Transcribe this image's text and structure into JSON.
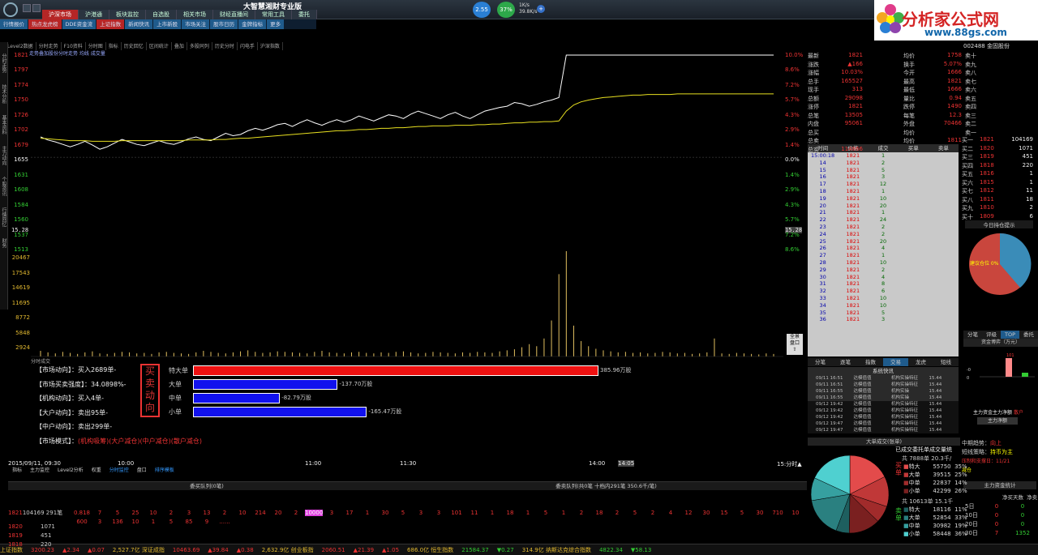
{
  "app": {
    "title": "大智慧湘财专业版"
  },
  "top_tabs": [
    "沪深市场",
    "沪港通",
    "板块监控",
    "自选股",
    "相关市场",
    "财经直播间",
    "常用工具",
    "委托"
  ],
  "active_top_tab": "沪深市场",
  "secondary_menu": [
    "行情报价",
    "热点龙虎榜",
    "DDE资金流",
    "上证指数",
    "新闻快讯",
    "上市新股",
    "市场关注",
    "股市日历",
    "金牌指标",
    "更多"
  ],
  "indicators": [
    {
      "value": "2.55"
    },
    {
      "value": "37%"
    }
  ],
  "net_speed": {
    "up": "1K/s",
    "down": "39.8K/s"
  },
  "brand": {
    "name": "分析家公式网",
    "url": "www.88gs.com"
  },
  "chart_toolbar": [
    "Level2数据",
    "分时走势",
    "F10资料",
    "分时图",
    "指标",
    "历史回忆",
    "区间统计",
    "叠加",
    "多股同列",
    "历史分时",
    "闪电手",
    "沪深指数"
  ],
  "chart_subtitle": "走势叠加股份分时走势 均线 成交量",
  "left_sidebar": [
    "分时走势",
    "技术分析",
    "基本资料",
    "主力动向",
    "个股资讯",
    "行情回忆",
    "财务"
  ],
  "y_left": [
    "1821",
    "1797",
    "1774",
    "1750",
    "1726",
    "1702",
    "1679",
    "1655",
    "1631",
    "1608",
    "1584",
    "1560",
    "1537",
    "1513"
  ],
  "y_right": [
    "10.0%",
    "8.6%",
    "7.2%",
    "5.7%",
    "4.3%",
    "2.9%",
    "1.4%",
    "0.0%",
    "1.4%",
    "2.9%",
    "4.3%",
    "5.7%",
    "7.2%",
    "8.6%"
  ],
  "crosshair_price": "15.28",
  "vol_labels": [
    "20467",
    "17543",
    "14619",
    "11695",
    "8772",
    "5848",
    "2924"
  ],
  "vol_title": "分时成交",
  "time_axis": [
    "2015/09/11, 09:30",
    "10:00",
    "11:00",
    "11:30",
    "14:00",
    "14:05",
    "15:分时▲"
  ],
  "quote_left": [
    {
      "k": "最新",
      "v": "1821"
    },
    {
      "k": "涨跌",
      "v": "▲166"
    },
    {
      "k": "涨幅",
      "v": "10.03%"
    },
    {
      "k": "总手",
      "v": "165527"
    },
    {
      "k": "现手",
      "v": "313"
    },
    {
      "k": "总额",
      "v": "29098"
    },
    {
      "k": "涨停",
      "v": "1821"
    },
    {
      "k": "总笔",
      "v": "13505"
    },
    {
      "k": "内盘",
      "v": "95061"
    },
    {
      "k": "总买",
      "v": ""
    },
    {
      "k": "总卖",
      "v": ""
    },
    {
      "k": "总实",
      "v": "114866"
    }
  ],
  "quote_right": [
    {
      "k": "均价",
      "v": "1758"
    },
    {
      "k": "换手",
      "v": "5.07%"
    },
    {
      "k": "今开",
      "v": "1666"
    },
    {
      "k": "最高",
      "v": "1821"
    },
    {
      "k": "最低",
      "v": "1666"
    },
    {
      "k": "量比",
      "v": "0.94"
    },
    {
      "k": "跌停",
      "v": "1490"
    },
    {
      "k": "每笔",
      "v": "12.3"
    },
    {
      "k": "外盘",
      "v": "70466"
    },
    {
      "k": "均价",
      "v": ""
    },
    {
      "k": "均价",
      "v": "1811"
    }
  ],
  "sell_levels": [
    "卖十",
    "卖九",
    "卖八",
    "卖七",
    "卖六",
    "卖五",
    "卖四",
    "卖三",
    "卖二",
    "卖一"
  ],
  "buy_levels": [
    {
      "name": "买一",
      "price": "1821",
      "vol": "104169"
    },
    {
      "name": "买二",
      "price": "1820",
      "vol": "1071"
    },
    {
      "name": "买三",
      "price": "1819",
      "vol": "451"
    },
    {
      "name": "买四",
      "price": "1818",
      "vol": "220"
    },
    {
      "name": "买五",
      "price": "1816",
      "vol": "1"
    },
    {
      "name": "买六",
      "price": "1815",
      "vol": "1"
    },
    {
      "name": "买七",
      "price": "1812",
      "vol": "11"
    },
    {
      "name": "买八",
      "price": "1811",
      "vol": "18"
    },
    {
      "name": "买九",
      "price": "1810",
      "vol": "2"
    },
    {
      "name": "买十",
      "price": "1809",
      "vol": "6"
    }
  ],
  "stock_code": "002488 金固股份",
  "trade_headers": [
    "时间",
    "价格",
    "成交",
    "买单",
    "卖单"
  ],
  "trades": [
    {
      "t": "15:00:18",
      "p": "1821",
      "v": "1"
    },
    {
      "t": "14",
      "p": "1821",
      "v": "2"
    },
    {
      "t": "15",
      "p": "1821",
      "v": "5"
    },
    {
      "t": "16",
      "p": "1821",
      "v": "3"
    },
    {
      "t": "17",
      "p": "1821",
      "v": "12"
    },
    {
      "t": "18",
      "p": "1821",
      "v": "1"
    },
    {
      "t": "19",
      "p": "1821",
      "v": "10"
    },
    {
      "t": "20",
      "p": "1821",
      "v": "20"
    },
    {
      "t": "21",
      "p": "1821",
      "v": "1"
    },
    {
      "t": "22",
      "p": "1821",
      "v": "24"
    },
    {
      "t": "23",
      "p": "1821",
      "v": "2"
    },
    {
      "t": "24",
      "p": "1821",
      "v": "2"
    },
    {
      "t": "25",
      "p": "1821",
      "v": "20"
    },
    {
      "t": "26",
      "p": "1821",
      "v": "4"
    },
    {
      "t": "27",
      "p": "1821",
      "v": "1"
    },
    {
      "t": "28",
      "p": "1821",
      "v": "10"
    },
    {
      "t": "29",
      "p": "1821",
      "v": "2"
    },
    {
      "t": "30",
      "p": "1821",
      "v": "4"
    },
    {
      "t": "31",
      "p": "1821",
      "v": "8"
    },
    {
      "t": "32",
      "p": "1821",
      "v": "6"
    },
    {
      "t": "33",
      "p": "1821",
      "v": "10"
    },
    {
      "t": "34",
      "p": "1821",
      "v": "10"
    },
    {
      "t": "35",
      "p": "1821",
      "v": "5"
    },
    {
      "t": "36",
      "p": "1821",
      "v": "3"
    }
  ],
  "trade_tabs": [
    "分笔",
    "逐笔",
    "指数",
    "交易",
    "龙虎",
    "短线"
  ],
  "pie1": {
    "title": "今日持仓提示",
    "label": "建议仓位 0%"
  },
  "right_tabs": [
    "分笔",
    "评级",
    "TOP",
    "委托"
  ],
  "mini_chart": {
    "title": "资金博弈（万元）",
    "caption": "主力资金主力净额",
    "caption2": "散户",
    "button": "主力净额",
    "val": "101"
  },
  "news_title": "系统快讯",
  "news_items": [
    {
      "d": "09/11 16:51",
      "a": "达模值值",
      "b": "机构实操特征",
      "c": "15.44"
    },
    {
      "d": "09/11 16:51",
      "a": "达模值值",
      "b": "机构实操特征",
      "c": "15.44"
    },
    {
      "d": "09/11 16:55",
      "a": "达模值值",
      "b": "机构实操",
      "c": "15.44"
    },
    {
      "d": "09/11 16:55",
      "a": "达模值值",
      "b": "机构实操",
      "c": "15.44"
    },
    {
      "d": "09/12 19:42",
      "a": "达模值值",
      "b": "机构实操特征",
      "c": "15.44"
    },
    {
      "d": "09/12 19:42",
      "a": "达模值值",
      "b": "机构实操特征",
      "c": "15.44"
    },
    {
      "d": "09/12 19:42",
      "a": "达模值值",
      "b": "机构实操特征",
      "c": "15.44"
    },
    {
      "d": "09/12 19:47",
      "a": "达模值值",
      "b": "机构实操特征",
      "c": "15.44"
    },
    {
      "d": "09/12 19:47",
      "a": "达模值值",
      "b": "机构实操特征",
      "c": "15.44"
    }
  ],
  "signal": {
    "t1": "中期趋势：",
    "v1": "向上",
    "t2": "短线策略：",
    "v2": "持币为主",
    "t3": "压制和支撑日：11/21",
    "t4": "减仓"
  },
  "big_order_title": "主力资金统计",
  "big_order_sub": [
    "净买天数",
    "净卖（万）"
  ],
  "days": [
    {
      "d": "5日",
      "v": "0"
    },
    {
      "d": "10日",
      "v": "0"
    },
    {
      "d": "20日",
      "v": "0"
    },
    {
      "d": "30日",
      "v": "7",
      "v2": "1352"
    }
  ],
  "pie2": {
    "title": "大单成交(张单)",
    "head": "已成交委托单成交量统",
    "buy_total": "共 7888单 20.3千/",
    "sell_total": "共 10613单 15.1千"
  },
  "pie2_rows_buy": [
    {
      "k": "特大",
      "n": "55750",
      "p": "35%"
    },
    {
      "k": "大单",
      "n": "39515",
      "p": "25%"
    },
    {
      "k": "中单",
      "n": "22837",
      "p": "14%"
    },
    {
      "k": "小单",
      "n": "42299",
      "p": "26%"
    }
  ],
  "pie2_rows_sell": [
    {
      "k": "特大",
      "n": "18116",
      "p": "11%"
    },
    {
      "k": "大单",
      "n": "52854",
      "p": "33%"
    },
    {
      "k": "中单",
      "n": "30982",
      "p": "19%"
    },
    {
      "k": "小单",
      "n": "58448",
      "p": "36%"
    }
  ],
  "flows": [
    {
      "label": "【市场动向】：",
      "value": "买入2689单-"
    },
    {
      "label": "【市场买卖强度】：",
      "value": "34.0898%-"
    },
    {
      "label": "【机构动向】：",
      "value": "买入4单-"
    },
    {
      "label": "【大户动向】：",
      "value": "卖出95单-"
    },
    {
      "label": "【中户动向】：",
      "value": "卖出299单-"
    },
    {
      "label": "【市场模式】：",
      "value": "(机构吸筹)(大户减仓)(中户减仓)(散户减仓)"
    }
  ],
  "flow_vertical": "买卖动向",
  "bars": [
    {
      "name": "特大单",
      "value": 385.96,
      "text": "385.96万股",
      "color": "#ee1111"
    },
    {
      "name": "大单",
      "value": -137.7,
      "text": "-137.70万股",
      "color": "#1111ee"
    },
    {
      "name": "中单",
      "value": -82.79,
      "text": "-82.79万股",
      "color": "#1111ee"
    },
    {
      "name": "小单",
      "value": -165.47,
      "text": "-165.47万股",
      "color": "#1111ee"
    }
  ],
  "bottom_tabs": [
    "指标",
    "主力监控",
    "Level2分析",
    "权重",
    "分时监控",
    "盘口",
    "排序模板"
  ],
  "tape_headers": [
    "委买队列(0笔)",
    "委卖队列(共0笔 十档内291笔 350.6千/笔)"
  ],
  "tape_rows": [
    {
      "p": "1821",
      "v": "104169",
      "n": "291笔",
      "items": [
        "0.818",
        "7",
        "5",
        "25",
        "10",
        "2",
        "3",
        "13",
        "2",
        "10",
        "214",
        "20",
        "2",
        "10000",
        "3",
        "17",
        "1",
        "30",
        "5",
        "3",
        "3",
        "101",
        "11",
        "1",
        "18",
        "1",
        "5",
        "1",
        "2",
        "18",
        "2",
        "5",
        "2",
        "4",
        "12",
        "30",
        "15",
        "5",
        "30",
        "710",
        "10"
      ]
    },
    {
      "p": "",
      "v": "",
      "n": "",
      "items": [
        "600",
        "3",
        "136",
        "10",
        "1",
        "5",
        "85",
        "9",
        "......"
      ]
    }
  ],
  "tape_side": [
    {
      "p": "1820",
      "v": "1071"
    },
    {
      "p": "1819",
      "v": "451"
    },
    {
      "p": "1818",
      "v": "220"
    }
  ],
  "status": [
    {
      "t": "上证指数",
      "c": "#e2b930"
    },
    {
      "t": "3200.23",
      "c": "#e33"
    },
    {
      "t": "▲2.34",
      "c": "#e33"
    },
    {
      "t": "▲0.07",
      "c": "#e33"
    },
    {
      "t": "2,527.7亿 深证成指",
      "c": "#e2b930"
    },
    {
      "t": "10463.69",
      "c": "#e33"
    },
    {
      "t": "▲39.84",
      "c": "#e33"
    },
    {
      "t": "▲0.38",
      "c": "#e33"
    },
    {
      "t": "2,632.9亿 创业板指",
      "c": "#e2b930"
    },
    {
      "t": "2060.51",
      "c": "#e33"
    },
    {
      "t": "▲21.39",
      "c": "#e33"
    },
    {
      "t": "▲1.05",
      "c": "#e33"
    },
    {
      "t": "686.0亿 恒生指数",
      "c": "#e2b930"
    },
    {
      "t": "21584.37",
      "c": "#3c3"
    },
    {
      "t": "▼0.27",
      "c": "#3c3"
    },
    {
      "t": "314.9亿 纳斯达克综合指数",
      "c": "#e2b930"
    },
    {
      "t": "4822.34",
      "c": "#3c3"
    },
    {
      "t": "▼58.13",
      "c": "#3c3"
    }
  ],
  "chart_data": {
    "type": "line",
    "title": "",
    "price_series": [
      1688,
      1683,
      1680,
      1676,
      1672,
      1676,
      1681,
      1675,
      1668,
      1672,
      1678,
      1684,
      1680,
      1676,
      1674,
      1678,
      1682,
      1678,
      1676,
      1680,
      1685,
      1688,
      1684,
      1682,
      1688,
      1694,
      1690,
      1692,
      1698,
      1702,
      1699,
      1703,
      1708,
      1710,
      1705,
      1711,
      1716,
      1711,
      1707,
      1712,
      1716,
      1712,
      1716,
      1722,
      1718,
      1714,
      1719,
      1724,
      1722,
      1718,
      1725,
      1730,
      1726,
      1722,
      1718,
      1724,
      1728,
      1722,
      1718,
      1724,
      1730,
      1733,
      1736,
      1738,
      1744,
      1742,
      1738,
      1741,
      1745,
      1748,
      1752,
      1821,
      1821,
      1821,
      1821,
      1821,
      1821,
      1821,
      1821,
      1821,
      1821,
      1821,
      1821,
      1821,
      1821,
      1821,
      1821,
      1821,
      1821,
      1821,
      1821,
      1821,
      1821,
      1821,
      1821,
      1821,
      1821,
      1821,
      1821,
      1821
    ],
    "avg_series": [
      1686,
      1685,
      1684,
      1683,
      1682,
      1682,
      1682,
      1681,
      1681,
      1681,
      1681,
      1682,
      1682,
      1682,
      1682,
      1682,
      1682,
      1682,
      1682,
      1682,
      1683,
      1683,
      1683,
      1683,
      1684,
      1684,
      1685,
      1686,
      1686,
      1687,
      1688,
      1689,
      1690,
      1691,
      1692,
      1693,
      1694,
      1695,
      1696,
      1697,
      1698,
      1698,
      1699,
      1700,
      1700,
      1701,
      1702,
      1702,
      1703,
      1703,
      1704,
      1705,
      1705,
      1706,
      1706,
      1706,
      1707,
      1707,
      1707,
      1708,
      1708,
      1709,
      1709,
      1710,
      1711,
      1711,
      1712,
      1712,
      1713,
      1713,
      1714,
      1730,
      1740,
      1745,
      1748,
      1750,
      1752,
      1753,
      1754,
      1755,
      1756,
      1756,
      1757,
      1757,
      1757,
      1757,
      1758,
      1758,
      1758,
      1758,
      1758,
      1758,
      1758,
      1758,
      1758,
      1758,
      1758,
      1758,
      1758,
      1758
    ],
    "ylim": [
      1513,
      1821
    ],
    "prev_close": 1655,
    "volume_series": [
      1100,
      800,
      600,
      900,
      700,
      500,
      800,
      1000,
      600,
      500,
      700,
      900,
      800,
      600,
      700,
      500,
      800,
      900,
      700,
      600,
      500,
      800,
      1100,
      900,
      700,
      600,
      800,
      1000,
      1200,
      900,
      700,
      800,
      1000,
      900,
      800,
      700,
      600,
      900,
      1100,
      800,
      700,
      600,
      800,
      900,
      700,
      600,
      800,
      700,
      900,
      1000,
      800,
      600,
      700,
      900,
      800,
      700,
      600,
      800,
      700,
      900,
      800,
      700,
      1000,
      1200,
      1400,
      1800,
      2400,
      2000,
      3500,
      7000,
      16000,
      20467,
      6000,
      3000,
      2000,
      1500,
      1200,
      1000,
      800,
      900,
      700,
      800,
      600,
      700,
      900,
      800,
      600,
      700,
      500,
      600,
      800,
      3500,
      600,
      500,
      700,
      600,
      500,
      400,
      600,
      500
    ],
    "vol_max": 20467
  }
}
